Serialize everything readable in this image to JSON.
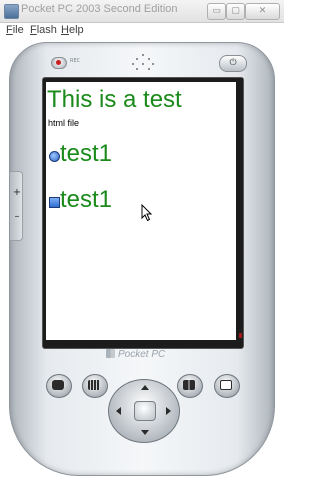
{
  "window": {
    "title": "Pocket PC 2003 Second Edition",
    "buttons": {
      "minimize": "▭",
      "restore": "▢",
      "close": "✕"
    }
  },
  "menubar": {
    "items": [
      {
        "accel": "F",
        "rest": "ile"
      },
      {
        "accel": "F",
        "rest": "lash"
      },
      {
        "accel": "H",
        "rest": "elp"
      }
    ]
  },
  "device": {
    "record_label": "REC",
    "side_up": "+",
    "side_down": "–",
    "power_glyph": "⏻",
    "brand": "Pocket PC"
  },
  "screen": {
    "heading": "This is a test",
    "subtitle": "html file",
    "items": [
      {
        "label": "test1",
        "control": "radio"
      },
      {
        "label": "test1",
        "control": "checkbox"
      }
    ]
  },
  "hardware_buttons": [
    {
      "icon": "windows-start-icon"
    },
    {
      "icon": "calendar-icon"
    },
    {
      "icon": "contacts-icon"
    },
    {
      "icon": "inbox-icon"
    }
  ],
  "colors": {
    "page_text": "#1a8a1a",
    "record_dot": "#c81e1e"
  }
}
